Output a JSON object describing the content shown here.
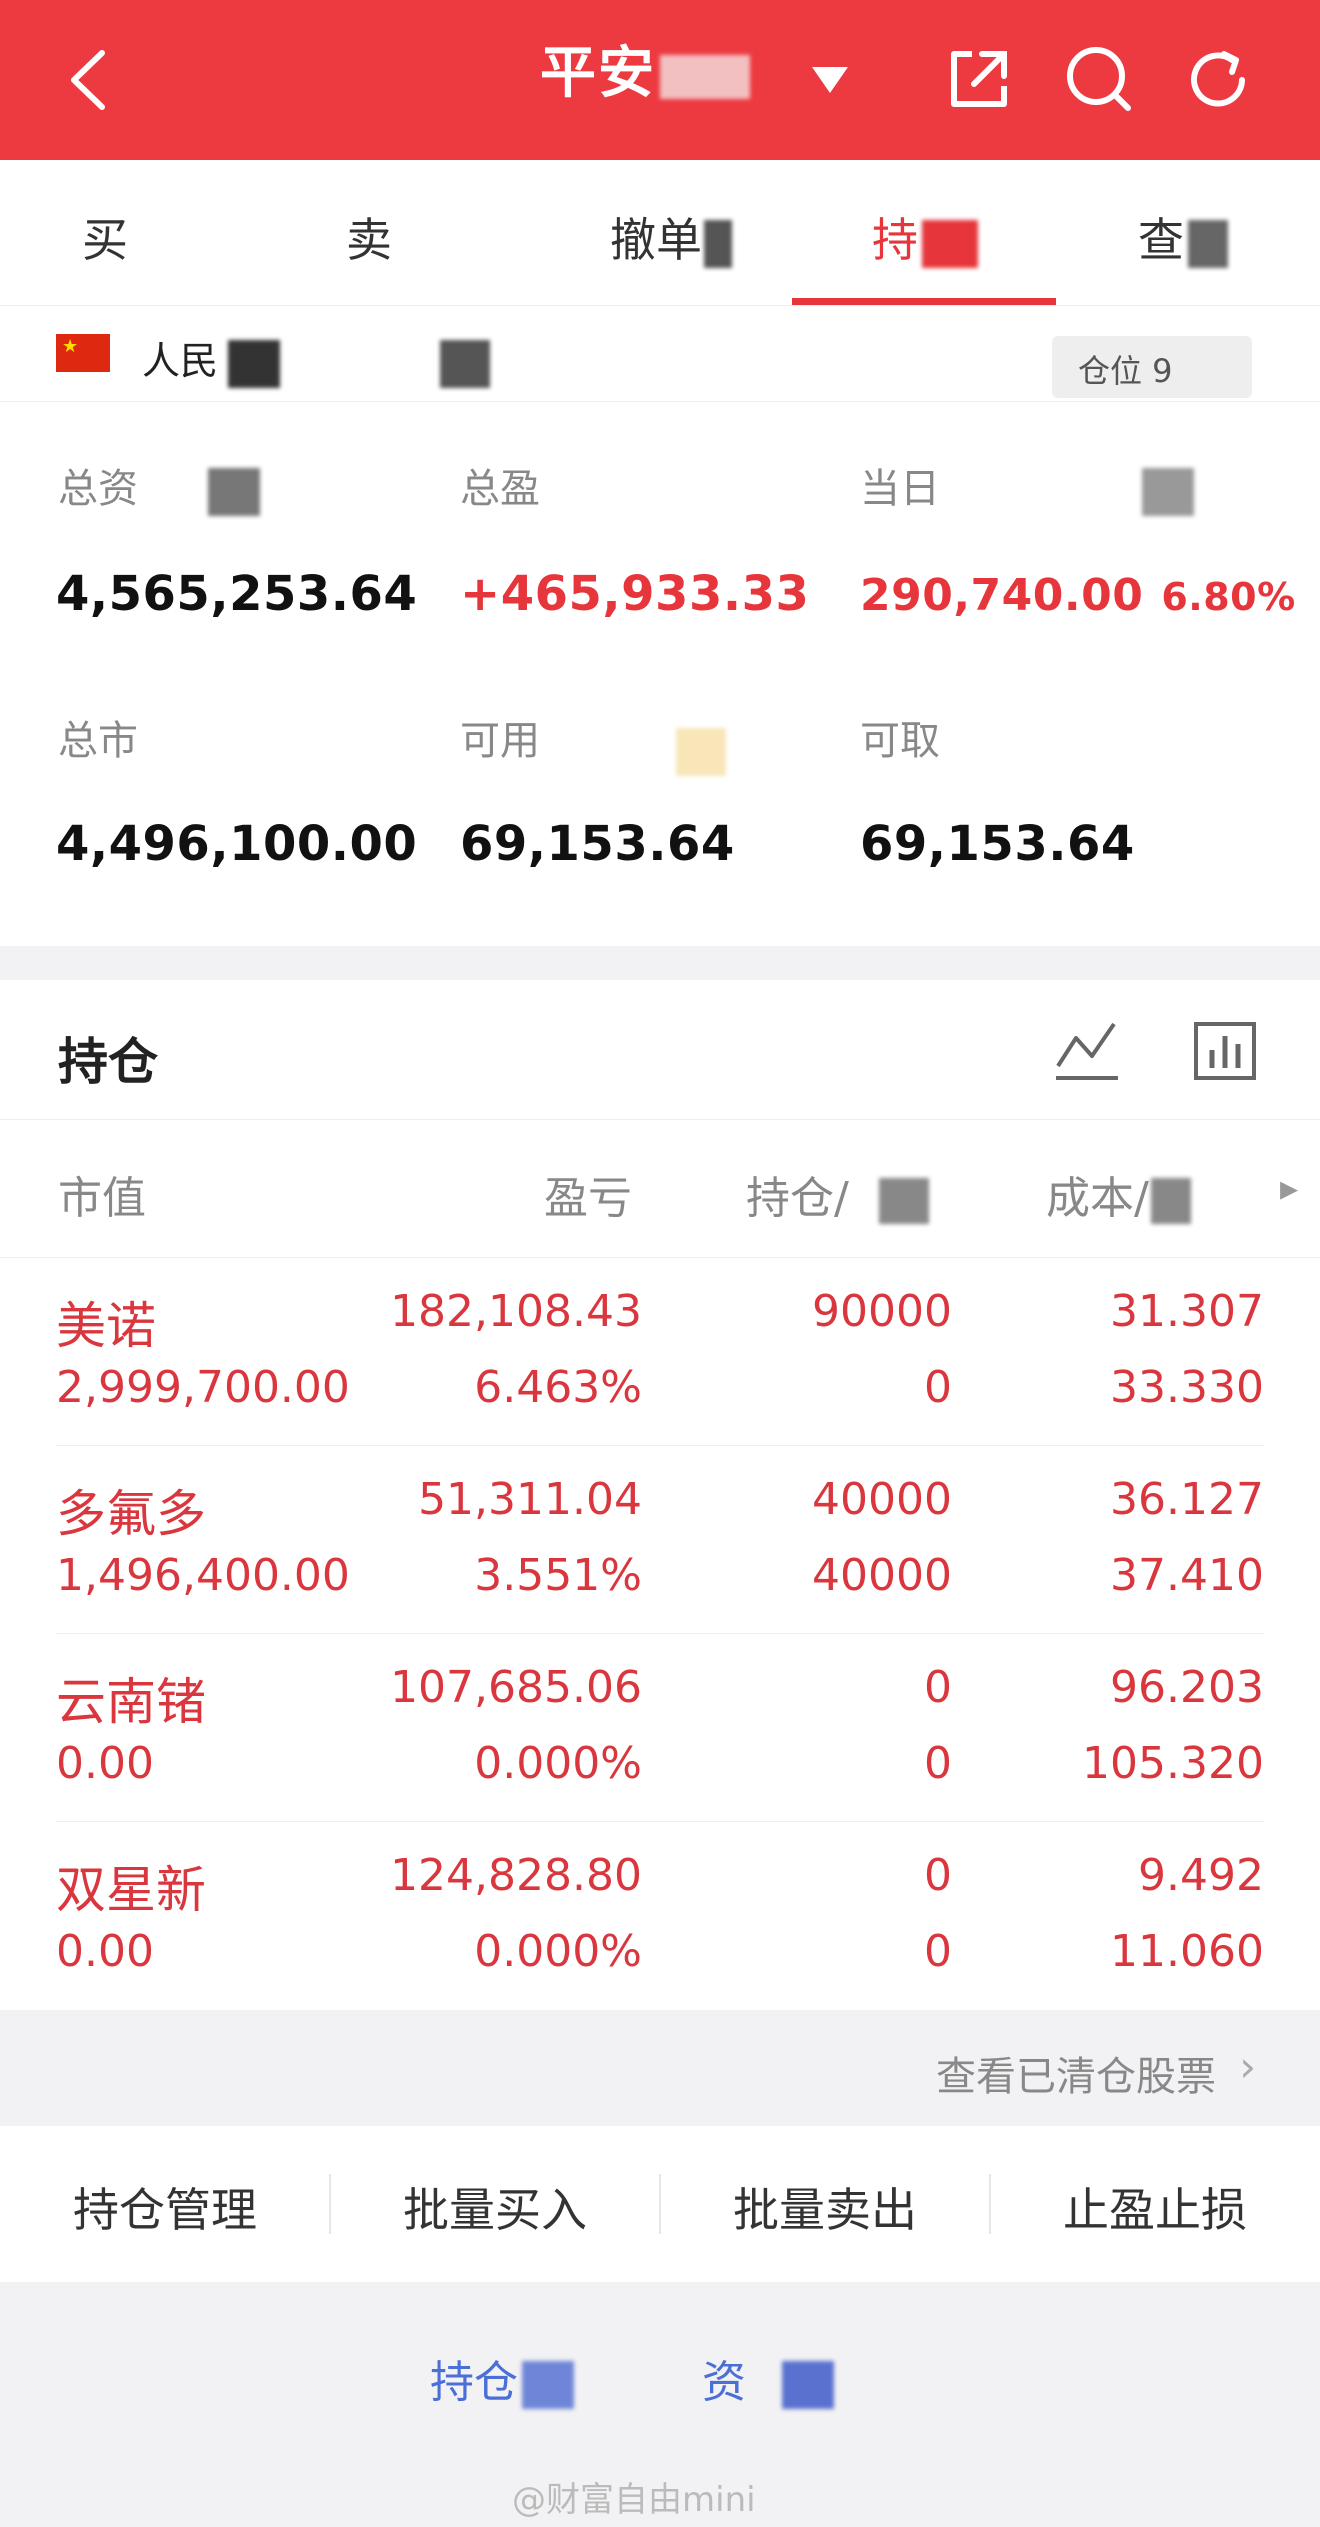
{
  "header": {
    "title": "平安",
    "sub": ""
  },
  "tabs": [
    {
      "label": "买"
    },
    {
      "label": "卖"
    },
    {
      "label": "撤单"
    },
    {
      "label": "持",
      "active": true
    },
    {
      "label": "查"
    }
  ],
  "account": {
    "currency": "人民",
    "position_badge": "仓位 9",
    "metrics": [
      {
        "label": "总资",
        "value": "4,565,253.64",
        "color": "normal"
      },
      {
        "label": "总盈",
        "value": "+465,933.33",
        "color": "red"
      },
      {
        "label": "当日",
        "value": "290,740.00",
        "pct": "6.80%",
        "color": "red"
      },
      {
        "label": "总市",
        "value": "4,496,100.00",
        "color": "normal"
      },
      {
        "label": "可用",
        "value": "69,153.64",
        "color": "normal"
      },
      {
        "label": "可取",
        "value": "69,153.64",
        "color": "normal"
      }
    ]
  },
  "holdings": {
    "title": "持仓",
    "columns": [
      "市值",
      "盈亏",
      "持仓/",
      "成本/"
    ],
    "rows": [
      {
        "name": "美诺",
        "market_value": "2,999,700.00",
        "pnl": "182,108.43",
        "pnl_pct": "6.463%",
        "position": "90000",
        "available": "0",
        "cost": "31.307",
        "price": "33.330"
      },
      {
        "name": "多氟多",
        "market_value": "1,496,400.00",
        "pnl": "51,311.04",
        "pnl_pct": "3.551%",
        "position": "40000",
        "available": "40000",
        "cost": "36.127",
        "price": "37.410"
      },
      {
        "name": "云南锗",
        "market_value": "0.00",
        "pnl": "107,685.06",
        "pnl_pct": "0.000%",
        "position": "0",
        "available": "0",
        "cost": "96.203",
        "price": "105.320"
      },
      {
        "name": "双星新",
        "market_value": "0.00",
        "pnl": "124,828.80",
        "pnl_pct": "0.000%",
        "position": "0",
        "available": "0",
        "cost": "9.492",
        "price": "11.060"
      }
    ],
    "cleared_link": "查看已清仓股票"
  },
  "actions": [
    "持仓管理",
    "批量买入",
    "批量卖出",
    "止盈止损"
  ],
  "bottom_nav": [
    "持仓",
    "资"
  ],
  "watermark": "@财富自由mini",
  "colors": {
    "brand_red": "#ec3a40",
    "accent_red": "#e6353b",
    "link_blue": "#4a6fd6"
  }
}
